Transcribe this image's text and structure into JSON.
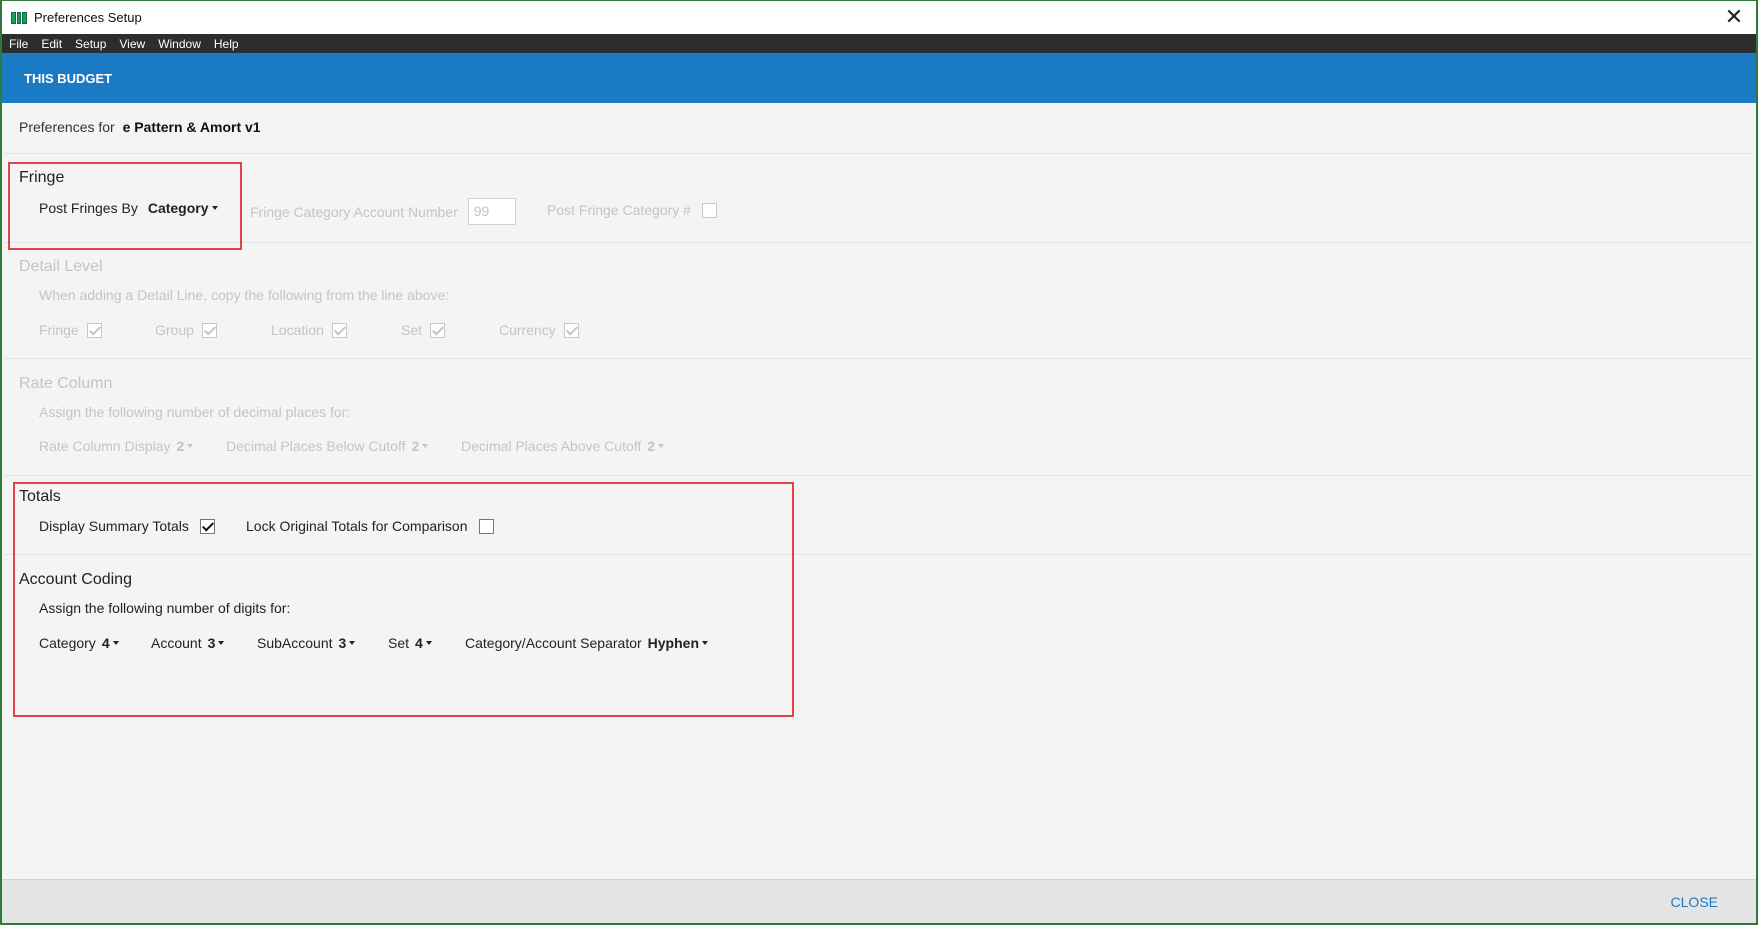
{
  "window": {
    "title": "Preferences Setup",
    "close_glyph": "✕"
  },
  "menu": [
    "File",
    "Edit",
    "Setup",
    "View",
    "Window",
    "Help"
  ],
  "header": {
    "label": "THIS BUDGET"
  },
  "preferences_for": {
    "label": "Preferences for",
    "budget_name": "e Pattern & Amort v1"
  },
  "fringe": {
    "title": "Fringe",
    "post_fringes_by_label": "Post Fringes By",
    "post_fringes_by_value": "Category",
    "account_number_label": "Fringe Category Account Number",
    "account_number_value": "99",
    "post_category_label": "Post Fringe Category #",
    "post_category_checked": false
  },
  "detail_level": {
    "title": "Detail Level",
    "description": "When adding a Detail Line, copy the following from the line above:",
    "options": [
      {
        "label": "Fringe",
        "checked": true
      },
      {
        "label": "Group",
        "checked": true
      },
      {
        "label": "Location",
        "checked": true
      },
      {
        "label": "Set",
        "checked": true
      },
      {
        "label": "Currency",
        "checked": true
      }
    ]
  },
  "rate_column": {
    "title": "Rate Column",
    "description": "Assign the following number of decimal places for:",
    "display_label": "Rate Column Display",
    "display_value": "2",
    "below_label": "Decimal Places Below Cutoff",
    "below_value": "2",
    "above_label": "Decimal Places Above Cutoff",
    "above_value": "2"
  },
  "totals": {
    "title": "Totals",
    "display_summary_label": "Display Summary Totals",
    "display_summary_checked": true,
    "lock_original_label": "Lock Original Totals for Comparison",
    "lock_original_checked": false
  },
  "account_coding": {
    "title": "Account Coding",
    "description": "Assign the following number of digits for:",
    "category_label": "Category",
    "category_value": "4",
    "account_label": "Account",
    "account_value": "3",
    "subaccount_label": "SubAccount",
    "subaccount_value": "3",
    "set_label": "Set",
    "set_value": "4",
    "separator_label": "Category/Account Separator",
    "separator_value": "Hyphen"
  },
  "footer": {
    "close_label": "CLOSE"
  },
  "colors": {
    "header_blue": "#1a7bc4",
    "highlight_red": "#e0434a",
    "menubar": "#2d2d2d"
  }
}
